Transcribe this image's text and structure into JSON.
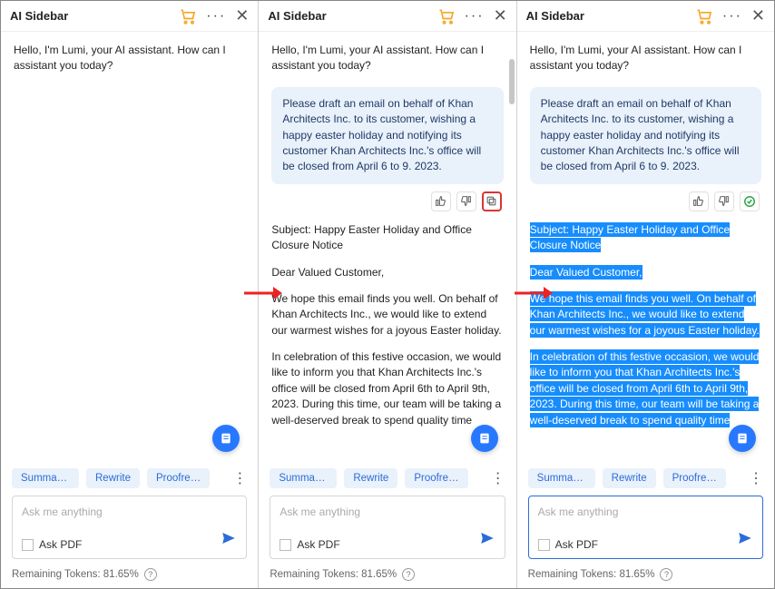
{
  "header": {
    "title": "AI Sidebar"
  },
  "greeting": "Hello, I'm Lumi, your AI assistant. How can I assistant you today?",
  "prompt": "Please draft an email on behalf of Khan Architects Inc. to its customer, wishing a happy easter holiday and notifying its customer Khan Architects Inc.'s office will be closed from April 6 to 9. 2023.",
  "response": {
    "subject": "Subject: Happy Easter Holiday and Office Closure Notice",
    "salutation": "Dear Valued Customer,",
    "p1": "We hope this email finds you well. On behalf of Khan Architects Inc., we would like to extend our warmest wishes for a joyous Easter holiday.",
    "p2": "In celebration of this festive occasion, we would like to inform you that Khan Architects Inc.'s office will be closed from April 6th to April 9th, 2023. During this time, our team will be taking a well-deserved break to spend quality time"
  },
  "actions": {
    "summarize": "Summar…",
    "rewrite": "Rewrite",
    "proofread": "Proofre…"
  },
  "input": {
    "placeholder": "Ask me anything",
    "askpdf": "Ask PDF"
  },
  "tokens": {
    "label": "Remaining Tokens: 81.65%"
  }
}
